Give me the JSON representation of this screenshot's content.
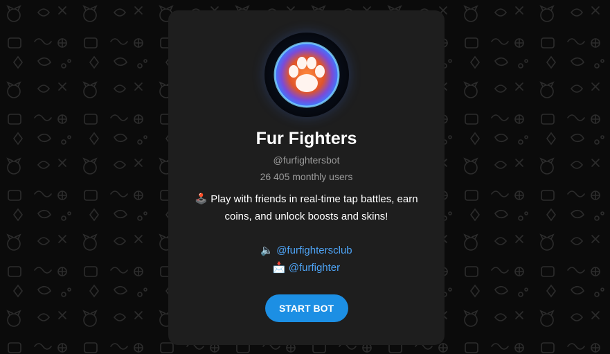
{
  "bot": {
    "name": "Fur Fighters",
    "handle": "@furfightersbot",
    "monthly_users": "26 405 monthly users",
    "description_emoji": "🕹️",
    "description": "Play with friends in real-time tap battles, earn coins, and unlock boosts and skins!",
    "avatar_icon": "paw-print-icon"
  },
  "links": [
    {
      "emoji": "🔈",
      "label": "@furfightersclub"
    },
    {
      "emoji": "📩",
      "label": "@furfighter"
    }
  ],
  "start_button": {
    "label": "START BOT"
  },
  "colors": {
    "background": "#0b0b0b",
    "card": "#1e1e1e",
    "accent": "#1c8fe4",
    "link": "#4ea4f6",
    "muted_text": "#9a9a9a"
  }
}
